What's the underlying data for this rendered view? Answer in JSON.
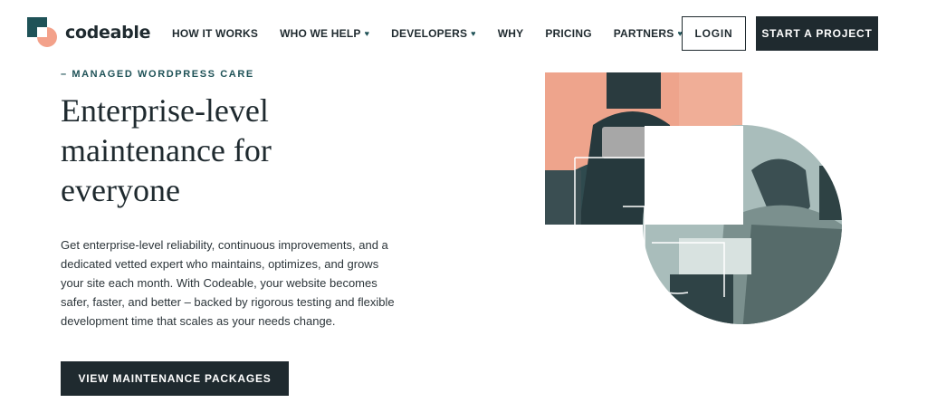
{
  "header": {
    "logo_text": "codeable",
    "nav": [
      {
        "label": "HOW IT WORKS",
        "has_icon": false
      },
      {
        "label": "WHO WE HELP",
        "has_icon": true
      },
      {
        "label": "DEVELOPERS",
        "has_icon": true
      },
      {
        "label": "WHY",
        "has_icon": false
      },
      {
        "label": "PRICING",
        "has_icon": false
      },
      {
        "label": "PARTNERS",
        "has_icon": true
      }
    ],
    "nav_icon_glyph": "♥",
    "login_label": "LOGIN",
    "start_label": "START A PROJECT"
  },
  "hero": {
    "eyebrow": "– MANAGED WORDPRESS CARE",
    "headline": [
      "Enterprise-level",
      "maintenance for",
      "everyone"
    ],
    "body": "Get enterprise-level reliability, continuous improvements, and a dedicated vetted expert who maintains, optimizes, and grows your site each month. With Codeable, your website becomes safer, faster, and better – backed by rigorous testing and flexible development time that scales as your needs change.",
    "cta_label": "VIEW MAINTENANCE PACKAGES"
  },
  "colors": {
    "dark": "#1f2a2f",
    "teal": "#1f5257",
    "peach": "#f3a18a",
    "sage": "#a9bdbb"
  },
  "icons": {
    "logo": "codeable-logo-icon",
    "dropdown": "heart-icon"
  }
}
